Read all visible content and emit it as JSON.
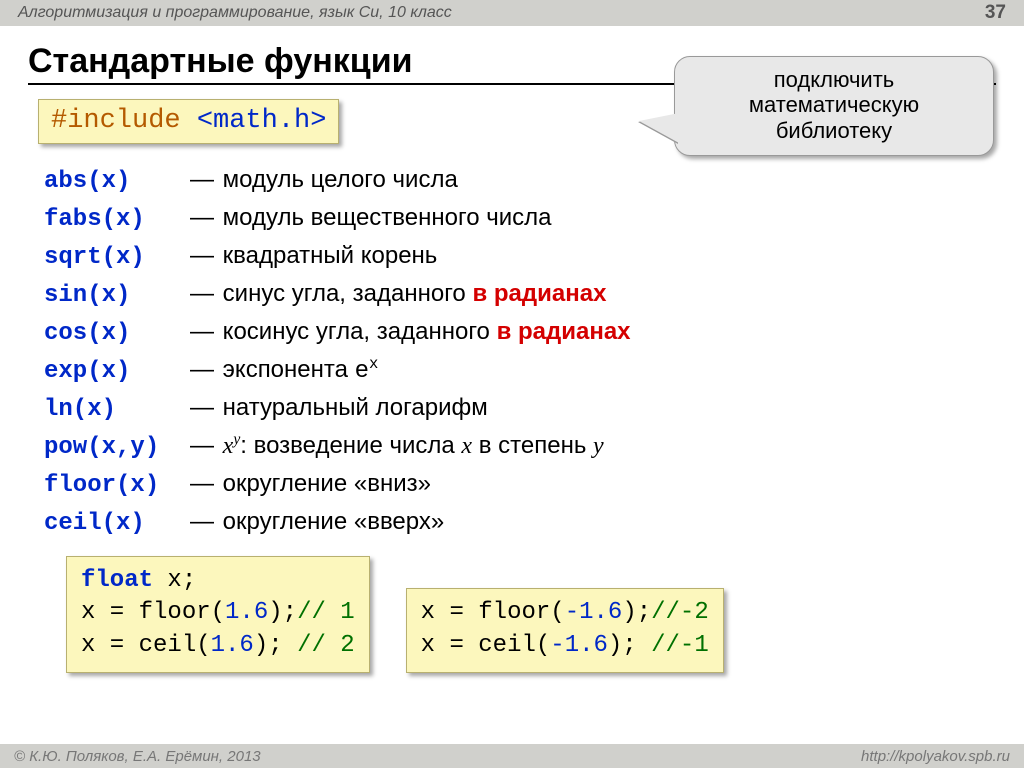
{
  "topbar": {
    "course": "Алгоритмизация и программирование, язык Си, 10 класс",
    "page": "37"
  },
  "title": "Стандартные функции",
  "callout": {
    "line1": "подключить",
    "line2": "математическую",
    "line3": "библиотеку"
  },
  "include": {
    "directive": "#include",
    "header": "<math.h>"
  },
  "functions": [
    {
      "sig": "abs(x)",
      "desc_pre": "модуль целого числа",
      "hl": "",
      "desc_post": ""
    },
    {
      "sig": "fabs(x)",
      "desc_pre": "модуль вещественного числа",
      "hl": "",
      "desc_post": ""
    },
    {
      "sig": "sqrt(x)",
      "desc_pre": "квадратный корень",
      "hl": "",
      "desc_post": ""
    },
    {
      "sig": "sin(x)",
      "desc_pre": "синус угла, заданного ",
      "hl": "в радианах",
      "desc_post": ""
    },
    {
      "sig": "cos(x)",
      "desc_pre": "косинус угла, заданного ",
      "hl": "в радианах",
      "desc_post": ""
    },
    {
      "sig": "exp(x)",
      "desc_pre": "экспонента ",
      "hl": "",
      "desc_post": "",
      "mono_base": "e",
      "mono_sup": "x"
    },
    {
      "sig": "ln(x)",
      "desc_pre": "натуральный логарифм",
      "hl": "",
      "desc_post": ""
    },
    {
      "sig": "pow(x,y)",
      "pow": true,
      "pow_base": "x",
      "pow_sup": "y",
      "pow_mid": ": возведение числа ",
      "pow_var1": "x",
      "pow_mid2": " в степень ",
      "pow_var2": "y"
    },
    {
      "sig": "floor(x)",
      "desc_pre": "округление «вниз»",
      "hl": "",
      "desc_post": ""
    },
    {
      "sig": "ceil(x)",
      "desc_pre": "округление «вверх»",
      "hl": "",
      "desc_post": ""
    }
  ],
  "dash": "—",
  "code": {
    "left": {
      "l1_type": "float",
      "l1_rest": " x;",
      "l2_a": "x = floor(",
      "l2_num": "1.6",
      "l2_b": ");",
      "l2_cmt": "// 1",
      "l3_a": "x = ceil(",
      "l3_num": "1.6",
      "l3_b": "); ",
      "l3_cmt": "// 2"
    },
    "right": {
      "l1_a": "x = floor(",
      "l1_num": "-1.6",
      "l1_b": ");",
      "l1_cmt": "//-2",
      "l2_a": "x = ceil(",
      "l2_num": "-1.6",
      "l2_b": "); ",
      "l2_cmt": "//-1"
    }
  },
  "footer": {
    "left": "© К.Ю. Поляков, Е.А. Ерёмин, 2013",
    "right": "http://kpolyakov.spb.ru"
  }
}
